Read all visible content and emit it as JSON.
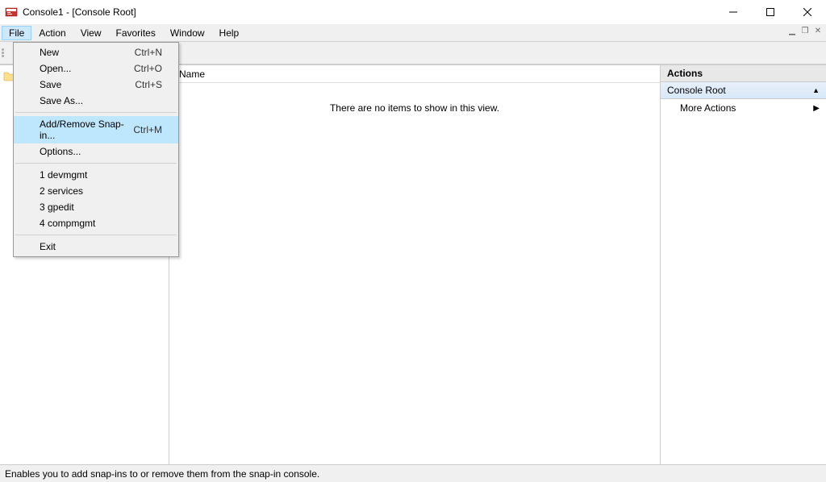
{
  "titlebar": {
    "title": "Console1 - [Console Root]"
  },
  "menubar": {
    "file": "File",
    "action": "Action",
    "view": "View",
    "favorites": "Favorites",
    "window": "Window",
    "help": "Help"
  },
  "fileMenu": {
    "new": {
      "label": "New",
      "shortcut": "Ctrl+N"
    },
    "open": {
      "label": "Open...",
      "shortcut": "Ctrl+O"
    },
    "save": {
      "label": "Save",
      "shortcut": "Ctrl+S"
    },
    "saveAs": {
      "label": "Save As..."
    },
    "addRemove": {
      "label": "Add/Remove Snap-in...",
      "shortcut": "Ctrl+M"
    },
    "options": {
      "label": "Options..."
    },
    "mru1": {
      "label": "1 devmgmt"
    },
    "mru2": {
      "label": "2 services"
    },
    "mru3": {
      "label": "3 gpedit"
    },
    "mru4": {
      "label": "4 compmgmt"
    },
    "exit": {
      "label": "Exit"
    }
  },
  "listPane": {
    "colName": "Name",
    "emptyMsg": "There are no items to show in this view."
  },
  "actionsPane": {
    "title": "Actions",
    "group": "Console Root",
    "moreActions": "More Actions"
  },
  "statusbar": {
    "text": "Enables you to add snap-ins to or remove them from the snap-in console."
  }
}
